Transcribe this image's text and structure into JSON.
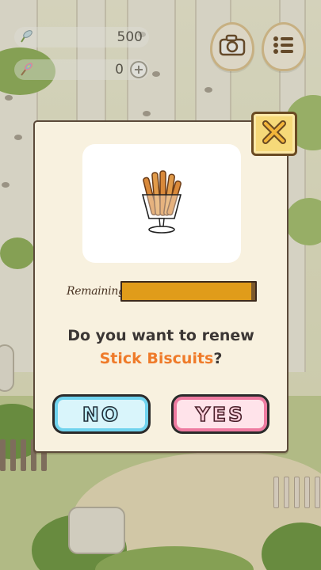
{
  "hud": {
    "clover_count": "500",
    "ticket_count": "0",
    "plus_label": "+",
    "clover_icon": "four-leaf-clover-icon",
    "ticket_icon": "rainbow-feather-icon",
    "camera_icon": "camera-icon",
    "menu_icon": "list-menu-icon"
  },
  "dialog": {
    "close_icon": "close-icon",
    "item_icon": "stick-biscuits-in-glass-icon",
    "remaining_label": "Remaining",
    "remaining_fraction": 1.0,
    "question_line1": "Do you want to renew",
    "item_name": "Stick Biscuits",
    "question_end": "?",
    "no_label": "NO",
    "yes_label": "YES"
  },
  "colors": {
    "accent_orange": "#ef7b2a",
    "progress_fill": "#e09c1a",
    "no_button": "#6fd3ee",
    "yes_button": "#ee7aa0",
    "close_button": "#f6d979"
  }
}
